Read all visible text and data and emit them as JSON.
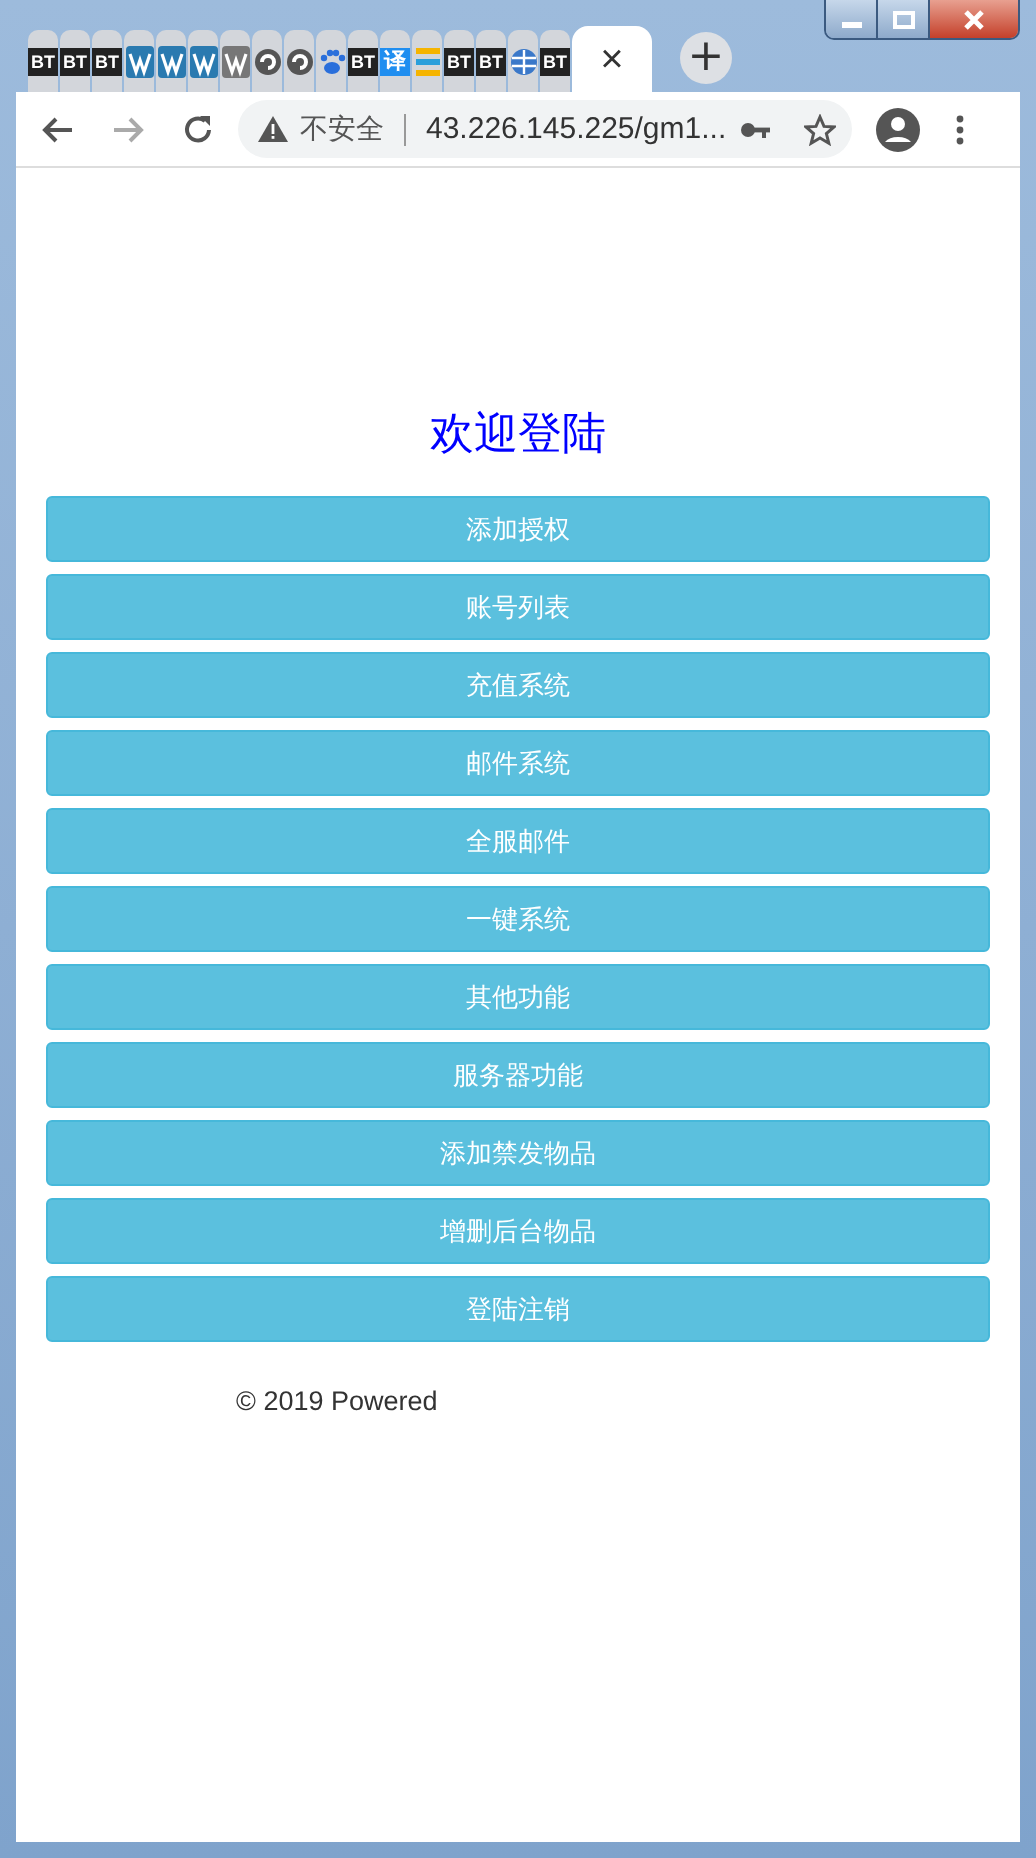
{
  "tabs": [
    {
      "kind": "bt",
      "text": "BT",
      "selected": false
    },
    {
      "kind": "bt",
      "text": "BT",
      "selected": false
    },
    {
      "kind": "bt",
      "text": "BT",
      "selected": false
    },
    {
      "kind": "wp",
      "selected": false
    },
    {
      "kind": "wp",
      "selected": false
    },
    {
      "kind": "wp",
      "selected": false
    },
    {
      "kind": "wp-grey",
      "selected": false
    },
    {
      "kind": "swirl",
      "selected": false
    },
    {
      "kind": "swirl",
      "selected": false
    },
    {
      "kind": "paw",
      "selected": false
    },
    {
      "kind": "bt",
      "text": "BT",
      "selected": false
    },
    {
      "kind": "translate",
      "text": "译",
      "selected": false
    },
    {
      "kind": "bars",
      "selected": false
    },
    {
      "kind": "bt",
      "text": "BT",
      "selected": false
    },
    {
      "kind": "bt",
      "text": "BT",
      "selected": false
    },
    {
      "kind": "globe",
      "selected": false
    },
    {
      "kind": "bt",
      "text": "BT",
      "selected": false
    },
    {
      "selected": true
    }
  ],
  "close_tab": "×",
  "new_tab": "+",
  "address": {
    "security": "不安全",
    "url": "43.226.145.225/gm1..."
  },
  "page": {
    "title": "欢迎登陆",
    "buttons": [
      "添加授权",
      "账号列表",
      "充值系统",
      "邮件系统",
      "全服邮件",
      "一键系统",
      "其他功能",
      "服务器功能",
      "添加禁发物品",
      "增删后台物品",
      "登陆注销"
    ],
    "footer": "© 2019 Powered"
  }
}
